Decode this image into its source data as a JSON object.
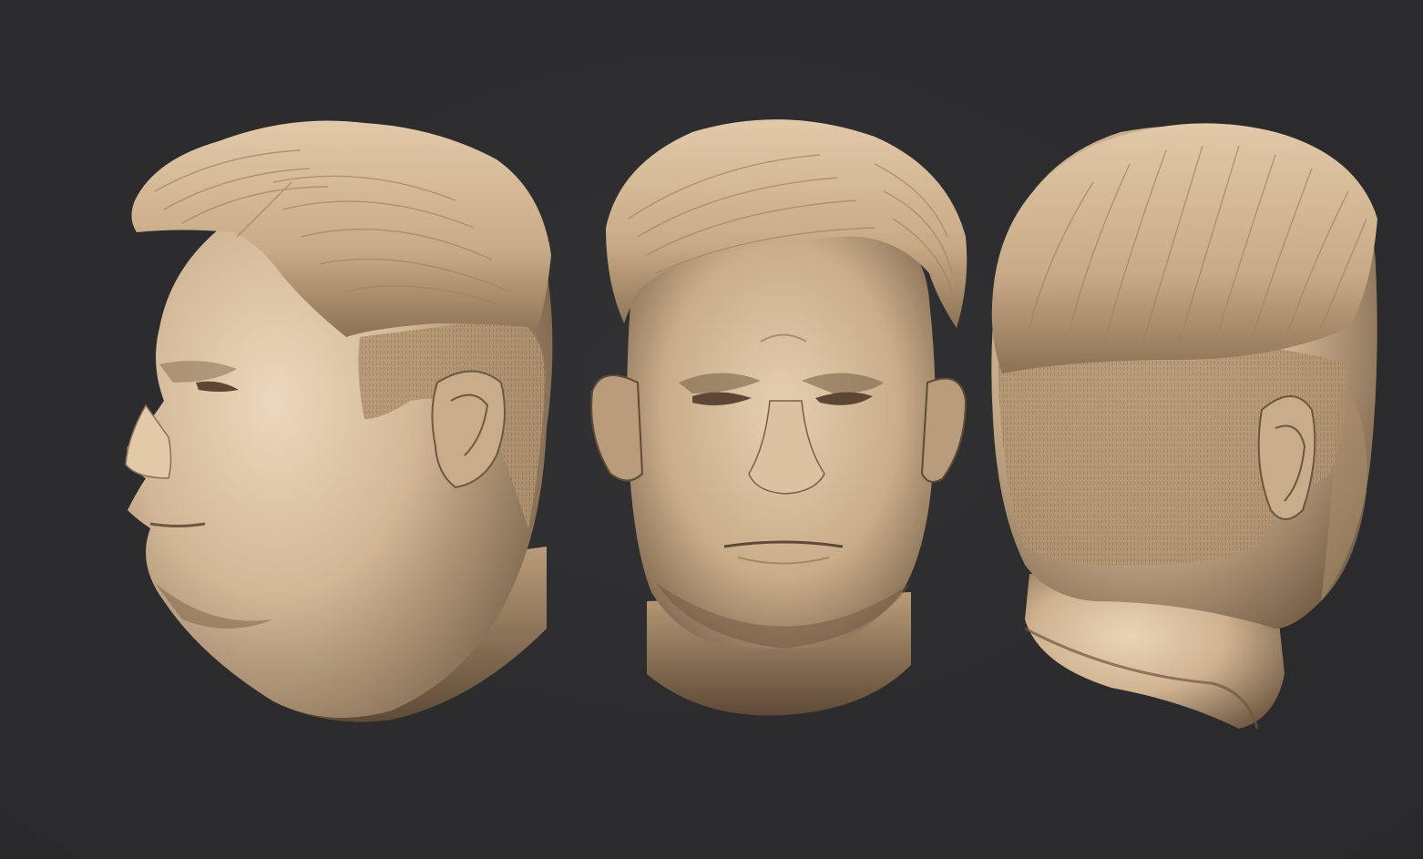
{
  "scene": {
    "background_color": "#2c2c2e",
    "clay_color": "#d2b796",
    "clay_shadow_color": "#7a6248",
    "clay_highlight_color": "#ecd8bc",
    "views": [
      {
        "name": "left-profile-view",
        "icon": "sculpted-head-three-quarter-left"
      },
      {
        "name": "front-view",
        "icon": "sculpted-head-front"
      },
      {
        "name": "back-view",
        "icon": "sculpted-head-back-three-quarter"
      }
    ]
  }
}
